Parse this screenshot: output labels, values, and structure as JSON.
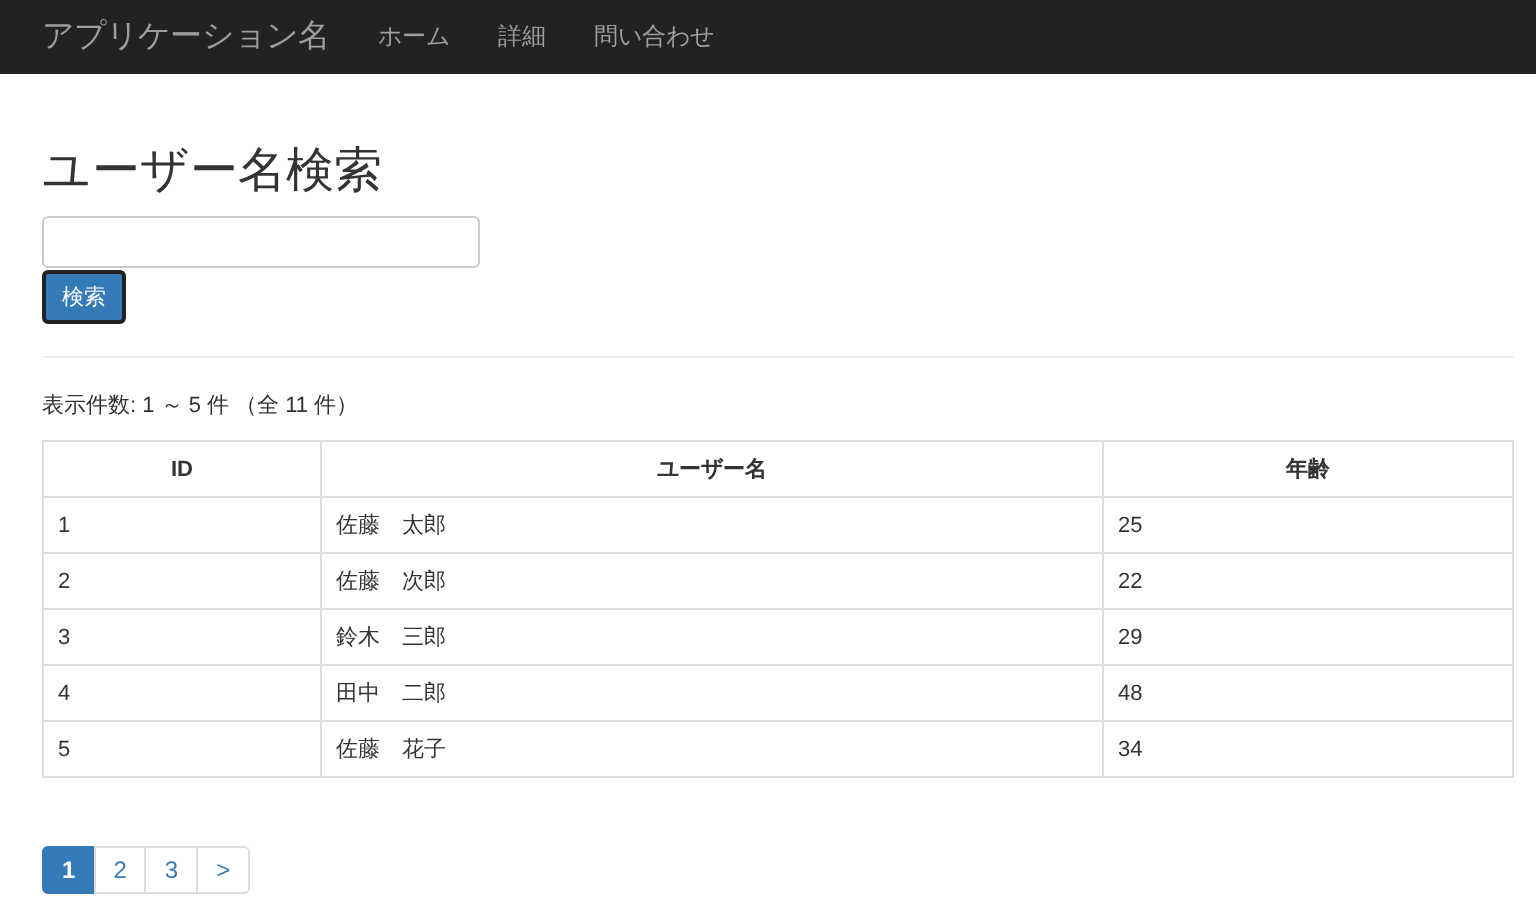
{
  "navbar": {
    "brand": "アプリケーション名",
    "links": [
      {
        "label": "ホーム"
      },
      {
        "label": "詳細"
      },
      {
        "label": "問い合わせ"
      }
    ]
  },
  "heading": "ユーザー名検索",
  "search": {
    "button": "検索"
  },
  "result_info": "表示件数: 1 ～ 5 件 （全 11 件）",
  "table": {
    "columns": [
      "ID",
      "ユーザー名",
      "年齢"
    ],
    "rows": [
      [
        "1",
        "佐藤　太郎",
        "25"
      ],
      [
        "2",
        "佐藤　次郎",
        "22"
      ],
      [
        "3",
        "鈴木　三郎",
        "29"
      ],
      [
        "4",
        "田中　二郎",
        "48"
      ],
      [
        "5",
        "佐藤　花子",
        "34"
      ]
    ]
  },
  "pagination": [
    {
      "label": "1",
      "selected": true
    },
    {
      "label": "2",
      "selected": false
    },
    {
      "label": "3",
      "selected": false
    },
    {
      "label": ">",
      "selected": false
    }
  ]
}
